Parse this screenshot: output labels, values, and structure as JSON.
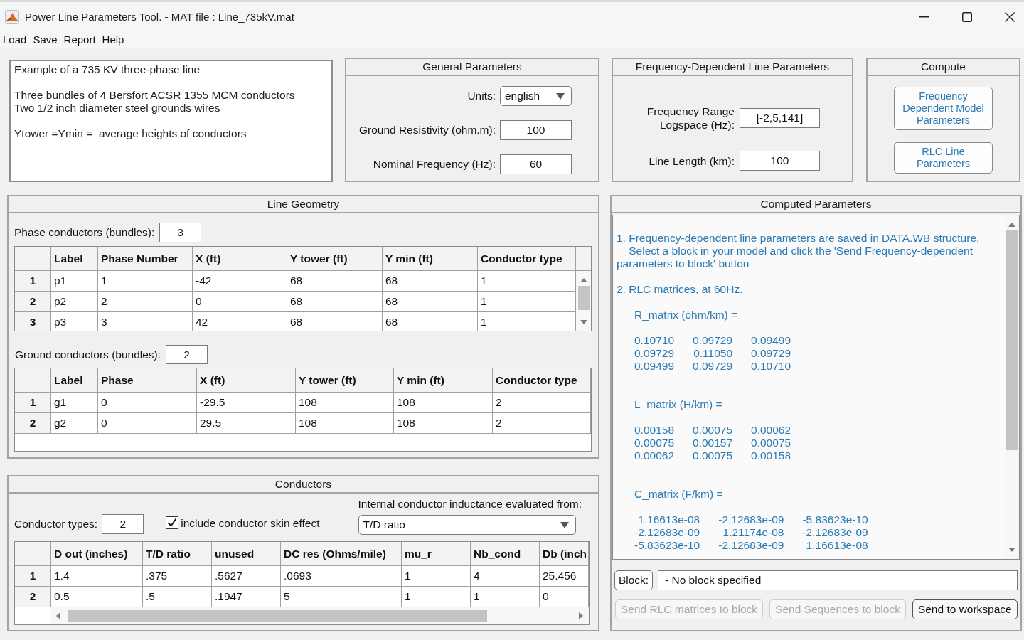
{
  "window": {
    "title": "Power Line Parameters Tool. - MAT file : Line_735kV.mat"
  },
  "menu": [
    "Load",
    "Save",
    "Report",
    "Help"
  ],
  "description": {
    "text": "Example of a 735 KV three-phase line\n\nThree bundles of 4 Bersfort ACSR 1355 MCM conductors\nTwo 1/2 inch diameter steel grounds wires\n\nYtower =Ymin =  average heights of conductors"
  },
  "general_parameters": {
    "title": "General Parameters",
    "fields": [
      {
        "kind": "dropdown",
        "label": "Units:",
        "value": "english"
      },
      {
        "kind": "input",
        "label": "Ground Resistivity (ohm.m):",
        "value": "100"
      },
      {
        "kind": "input",
        "label": "Nominal Frequency (Hz):",
        "value": "60"
      }
    ]
  },
  "frequency_dependent_parameters": {
    "title": "Frequency-Dependent Line Parameters",
    "fields": [
      {
        "kind": "input",
        "label": "Frequency Range\nLogspace (Hz):",
        "value": "[-2,5,141]"
      },
      {
        "kind": "input",
        "label": "Line Length (km):",
        "value": "100"
      }
    ]
  },
  "compute": {
    "title": "Compute",
    "buttons": [
      "Frequency Dependent Model Parameters",
      "RLC Line Parameters"
    ]
  },
  "line_geometry": {
    "title": "Line Geometry",
    "phase_conductors": {
      "label": "Phase conductors (bundles):",
      "value": "3",
      "table": {
        "columns": [
          "Label",
          "Phase Number",
          "X (ft)",
          "Y tower (ft)",
          "Y min (ft)",
          "Conductor type"
        ],
        "rows": [
          {
            "header": "1",
            "cells": [
              "p1",
              "1",
              "-42",
              "68",
              "68",
              "1"
            ]
          },
          {
            "header": "2",
            "cells": [
              "p2",
              "2",
              "0",
              "68",
              "68",
              "1"
            ]
          },
          {
            "header": "3",
            "cells": [
              "p3",
              "3",
              "42",
              "68",
              "68",
              "1"
            ]
          }
        ]
      }
    },
    "ground_conductors": {
      "label": "Ground conductors (bundles):",
      "value": "2",
      "table": {
        "columns": [
          "Label",
          "Phase",
          "X (ft)",
          "Y tower (ft)",
          "Y min (ft)",
          "Conductor type"
        ],
        "rows": [
          {
            "header": "1",
            "cells": [
              "g1",
              "0",
              "-29.5",
              "108",
              "108",
              "2"
            ]
          },
          {
            "header": "2",
            "cells": [
              "g2",
              "0",
              "29.5",
              "108",
              "108",
              "2"
            ]
          }
        ]
      }
    }
  },
  "conductors": {
    "title": "Conductors",
    "types": {
      "label": "Conductor types:",
      "value": "2"
    },
    "skin_effect": {
      "label": "include conductor skin effect",
      "checked": true
    },
    "inductance": {
      "label": "Internal conductor inductance evaluated from:",
      "value": "T/D ratio"
    },
    "table": {
      "columns": [
        "D out (inches)",
        "T/D ratio",
        "unused",
        "DC res (Ohms/mile)",
        "mu_r",
        "Nb_cond",
        "Db (inch"
      ],
      "rows": [
        {
          "header": "1",
          "cells": [
            "1.4",
            ".375",
            ".5627",
            ".0693",
            "1",
            "4",
            "25.456"
          ]
        },
        {
          "header": "2",
          "cells": [
            "0.5",
            ".5",
            ".1947",
            "5",
            "1",
            "1",
            "0"
          ]
        }
      ]
    }
  },
  "computed_parameters": {
    "title": "Computed Parameters",
    "notes": [
      "1. Frequency-dependent line parameters are saved in DATA.WB structure.\n    Select a block in your model and click the 'Send Frequency-dependent\nparameters to block' button",
      "2. RLC matrices, at 60Hz."
    ],
    "matrices": [
      {
        "label": "R_matrix (ohm/km) =",
        "rows": [
          [
            "0.10710",
            "0.09729",
            "0.09499"
          ],
          [
            "0.09729",
            "0.11050",
            "0.09729"
          ],
          [
            "0.09499",
            "0.09729",
            "0.10710"
          ]
        ]
      },
      {
        "label": "L_matrix (H/km) =",
        "rows": [
          [
            "0.00158",
            "0.00075",
            "0.00062"
          ],
          [
            "0.00075",
            "0.00157",
            "0.00075"
          ],
          [
            "0.00062",
            "0.00075",
            "0.00158"
          ]
        ]
      },
      {
        "label": "C_matrix (F/km) =",
        "rows": [
          [
            "1.16613e-08",
            "-2.12683e-09",
            "-5.83623e-10"
          ],
          [
            "-2.12683e-09",
            "1.21174e-08",
            "-2.12683e-09"
          ],
          [
            "-5.83623e-10",
            "-2.12683e-09",
            "1.16613e-08"
          ]
        ]
      }
    ],
    "block": {
      "button": "Block:",
      "value": "- No block specified"
    },
    "buttons": [
      {
        "label": "Send RLC matrices to block",
        "disabled": true
      },
      {
        "label": "Send Sequences to block",
        "disabled": true
      },
      {
        "label": "Send to workspace",
        "disabled": false
      }
    ]
  }
}
